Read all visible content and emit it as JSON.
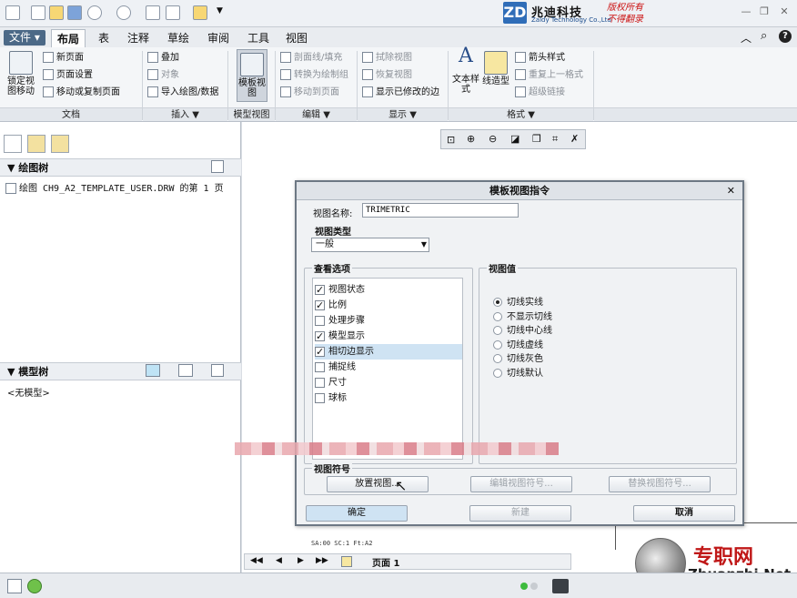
{
  "qat": {
    "dropdown": "▼"
  },
  "logo": {
    "box": "ZD",
    "main": "兆迪科技",
    "sub": "Zaldy Technology Co.,Ltd",
    "red1": "版权所有",
    "red2": "不得翻录"
  },
  "tabs": [
    "文件 ▾",
    "布局",
    "表",
    "注释",
    "草绘",
    "审阅",
    "工具",
    "视图"
  ],
  "ribbon": {
    "lock_label": "锁定视图移动",
    "doc": [
      "新页面",
      "页面设置",
      "移动或复制页面"
    ],
    "insert": [
      "叠加",
      "对象",
      "导入绘图/数据"
    ],
    "model_view": "模板视图",
    "edit": [
      "剖面线/填充",
      "转换为绘制组",
      "移动到页面"
    ],
    "display": [
      "拭除视图",
      "恢复视图",
      "显示已修改的边"
    ],
    "text_style": "文本样式",
    "line_style": "线造型",
    "format": [
      "箭头样式",
      "重复上一格式",
      "超级链接"
    ],
    "groups": [
      "文档",
      "插入 ▼",
      "模型视图",
      "编辑 ▼",
      "显示 ▼",
      "格式 ▼"
    ]
  },
  "left": {
    "drawing_tree": "绘图树",
    "drawing_item": "绘图 CH9_A2_TEMPLATE_USER.DRW 的第 1 页",
    "model_tree": "模型树",
    "no_model": "<无模型>"
  },
  "dialog": {
    "title": "模板视图指令",
    "name_label": "视图名称:",
    "name_value": "TRIMETRIC",
    "type_label": "视图类型",
    "type_value": "一般",
    "options_label": "查看选项",
    "options": [
      {
        "label": "视图状态",
        "checked": true
      },
      {
        "label": "比例",
        "checked": true
      },
      {
        "label": "处理步骤",
        "checked": false
      },
      {
        "label": "模型显示",
        "checked": true
      },
      {
        "label": "相切边显示",
        "checked": true
      },
      {
        "label": "捕捉线",
        "checked": false
      },
      {
        "label": "尺寸",
        "checked": false
      },
      {
        "label": "球标",
        "checked": false
      }
    ],
    "values_label": "视图值",
    "values": [
      {
        "label": "切线实线",
        "on": true
      },
      {
        "label": "不显示切线",
        "on": false
      },
      {
        "label": "切线中心线",
        "on": false
      },
      {
        "label": "切线虚线",
        "on": false
      },
      {
        "label": "切线灰色",
        "on": false
      },
      {
        "label": "切线默认",
        "on": false
      }
    ],
    "symbol_label": "视图符号",
    "place_btn": "放置视图...",
    "edit_btn": "编辑视图符号...",
    "replace_btn": "替换视图符号...",
    "ok": "确定",
    "new": "新建",
    "cancel": "取消"
  },
  "canvas": {
    "sheet_info": "SA:00  SC:1  Ft:A2",
    "page_label": "页面 1"
  },
  "watermark": {
    "cn": "专职网",
    "url": "Zhuanzhi.Net"
  }
}
